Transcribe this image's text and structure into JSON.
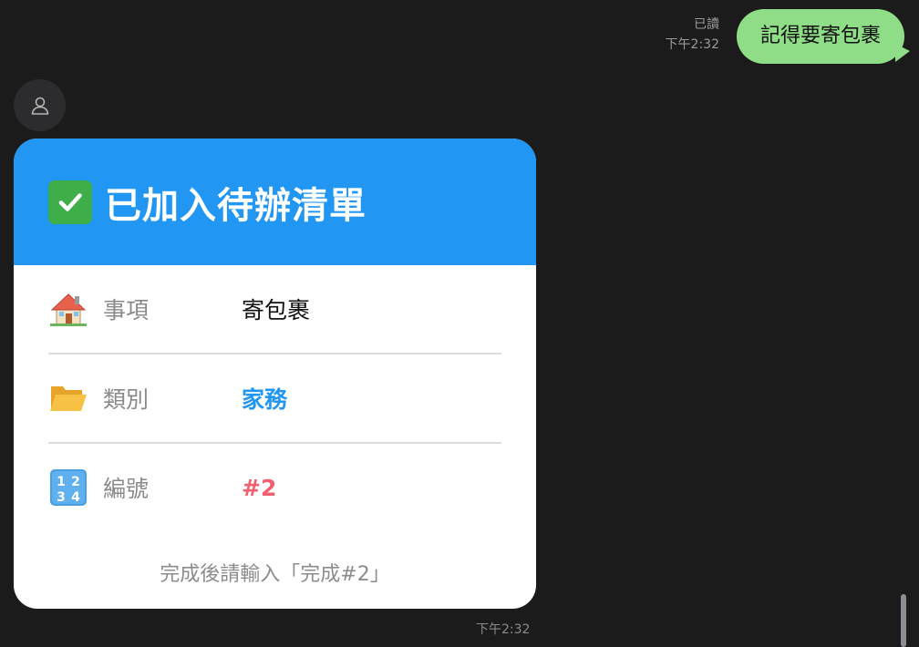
{
  "outgoing": {
    "read_status": "已讀",
    "time": "下午2:32",
    "text": "記得要寄包裹"
  },
  "incoming": {
    "avatar_icon": "user-silhouette-icon",
    "card": {
      "header_icon": "check-mark-button-icon",
      "title": "已加入待辦清單",
      "rows": [
        {
          "icon": "house-icon",
          "label": "事項",
          "value": "寄包裹"
        },
        {
          "icon": "open-folder-icon",
          "label": "類別",
          "value": "家務"
        },
        {
          "icon": "numbers-1234-icon",
          "label": "編號",
          "value": "#2"
        }
      ],
      "footer": "完成後請輸入「完成#2」",
      "colors": {
        "header": "#2196f3",
        "category": "#2196f3",
        "number": "#f25f6e"
      }
    },
    "time": "下午2:32"
  },
  "colors": {
    "background": "#1b1b1c",
    "outgoing_bubble": "#8fde87"
  }
}
